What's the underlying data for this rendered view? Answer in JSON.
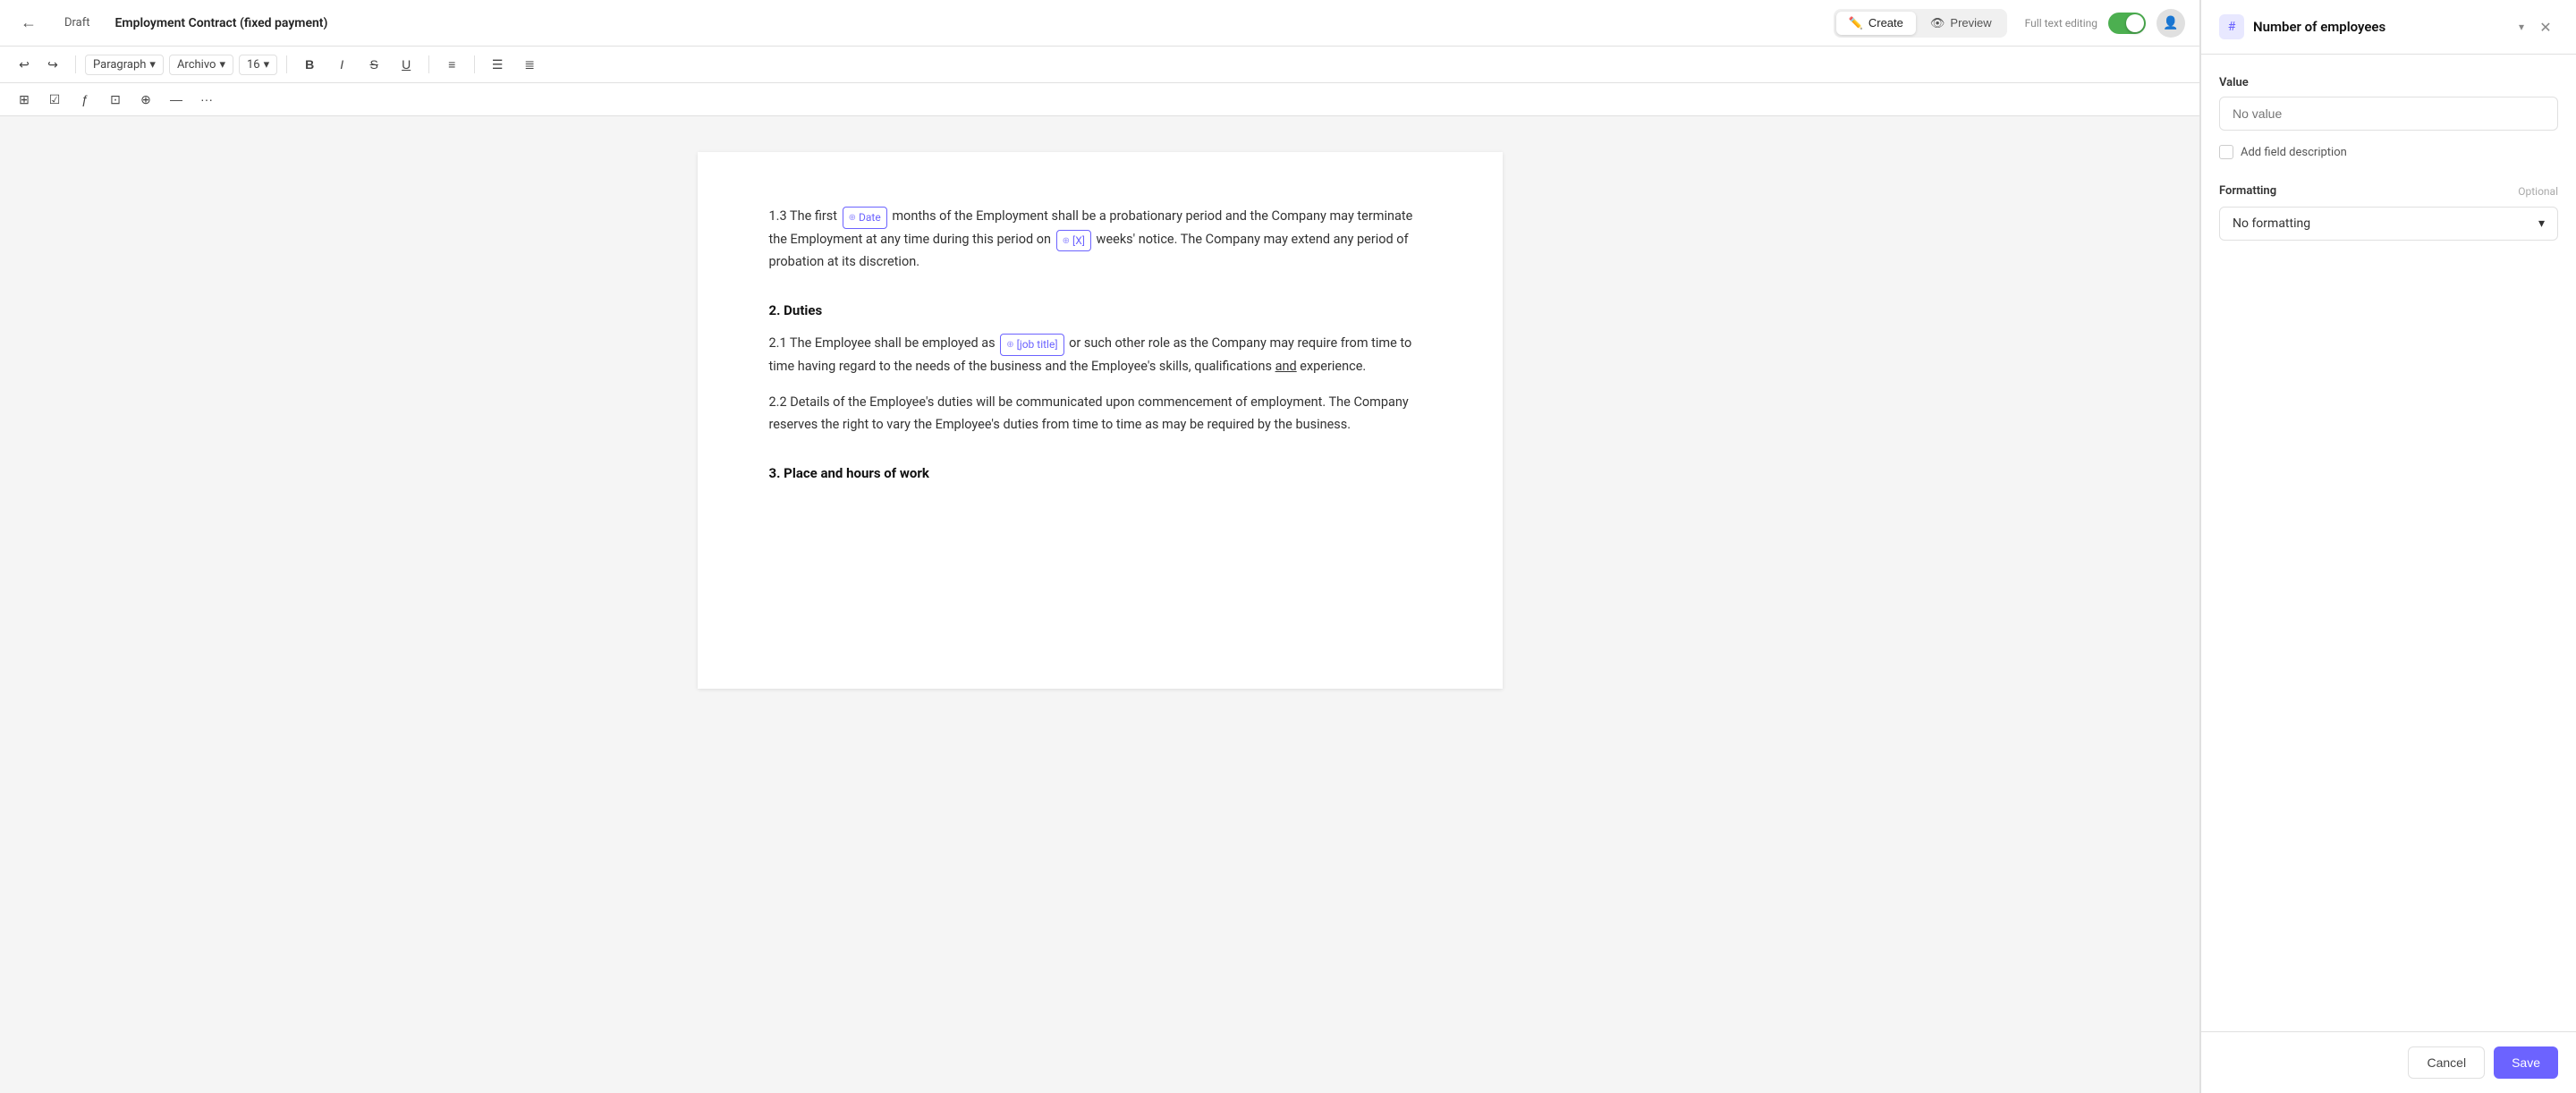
{
  "topbar": {
    "back_icon": "←",
    "draft_label": "Draft",
    "doc_title": "Employment Contract (fixed payment)",
    "create_tab": "Create",
    "preview_tab": "Preview",
    "full_text_label": "Full text editing",
    "users_icon": "👤",
    "chevron_icon": "▾"
  },
  "toolbar": {
    "undo_icon": "↩",
    "redo_icon": "↪",
    "paragraph_label": "Paragraph",
    "font_label": "Archivo",
    "size_label": "16",
    "bold_icon": "B",
    "italic_icon": "I",
    "strikethrough_icon": "S",
    "underline_icon": "U",
    "align_icon": "≡",
    "list_icon": "☰",
    "ordered_icon": "≣"
  },
  "toolbar2": {
    "block_icon": "⊞",
    "table_icon": "⊡",
    "formula_icon": "ƒ",
    "grid_icon": "⊟",
    "attach_icon": "⊕",
    "divider_icon": "—",
    "more_icon": "···"
  },
  "editor": {
    "section_1_3": {
      "text_before": "1.3 The first ",
      "tag1_label": "Date",
      "text_middle": " months of the Employment shall be a probationary period and the Company may terminate the Employment at any time during this period on ",
      "tag2_label": "[X]",
      "text_after": " weeks' notice. The Company may extend any period of probation at its discretion."
    },
    "section_2_heading": "2. Duties",
    "section_2_1": {
      "text_before": "2.1 The Employee shall be employed as ",
      "tag1_label": "[job title]",
      "text_after": " or such other role as the Company may require from time to time having regard to the needs of the business and the Employee's skills, qualifications ",
      "underline_text": "and",
      "text_end": " experience."
    },
    "section_2_2": "2.2 Details of the Employee's duties will be communicated upon commencement of employment. The Company reserves the right to vary the Employee's duties from time to time as may be required by the business.",
    "section_3_heading": "3. Place and hours of work"
  },
  "panel": {
    "title": "Number of employees",
    "chevron_icon": "▾",
    "close_icon": "✕",
    "field_icon": "#",
    "value_section": {
      "label": "Value",
      "placeholder": "No value"
    },
    "add_description_label": "Add field description",
    "formatting_section": {
      "label": "Formatting",
      "optional_label": "Optional",
      "dropdown_value": "No formatting",
      "dropdown_icon": "▾"
    },
    "cancel_label": "Cancel",
    "save_label": "Save"
  }
}
